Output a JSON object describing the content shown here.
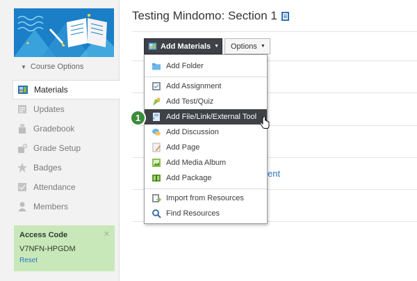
{
  "page": {
    "title": "Testing Mindomo: Section 1"
  },
  "sidebar": {
    "course_options": "Course Options",
    "items": [
      {
        "label": "Materials",
        "icon": "materials-icon",
        "active": true
      },
      {
        "label": "Updates",
        "icon": "updates-icon",
        "active": false
      },
      {
        "label": "Gradebook",
        "icon": "gradebook-icon",
        "active": false
      },
      {
        "label": "Grade Setup",
        "icon": "grade-setup-icon",
        "active": false
      },
      {
        "label": "Badges",
        "icon": "badge-icon",
        "active": false
      },
      {
        "label": "Attendance",
        "icon": "attendance-icon",
        "active": false
      },
      {
        "label": "Members",
        "icon": "members-icon",
        "active": false
      }
    ],
    "access_code": {
      "title": "Access Code",
      "code": "V7NFN-HPGDM",
      "reset": "Reset"
    }
  },
  "toolbar": {
    "add_materials": "Add Materials",
    "options": "Options"
  },
  "menu": {
    "items": [
      {
        "label": "Add Folder",
        "icon": "folder-icon"
      },
      {
        "label": "Add Assignment",
        "icon": "assignment-icon"
      },
      {
        "label": "Add Test/Quiz",
        "icon": "quiz-icon"
      },
      {
        "label": "Add File/Link/External Tool",
        "icon": "file-link-icon",
        "highlighted": true
      },
      {
        "label": "Add Discussion",
        "icon": "discussion-icon"
      },
      {
        "label": "Add Page",
        "icon": "page-icon"
      },
      {
        "label": "Add Media Album",
        "icon": "media-album-icon"
      },
      {
        "label": "Add Package",
        "icon": "package-icon"
      },
      {
        "label": "Import from Resources",
        "icon": "import-icon"
      },
      {
        "label": "Find Resources",
        "icon": "search-icon"
      }
    ]
  },
  "background": {
    "partial_link": "ent"
  },
  "annotation": {
    "step": "1"
  },
  "colors": {
    "accent": "#3e4146",
    "link": "#2a77c2",
    "access_bg": "#c9e8b9",
    "step_badge": "#3b8c3b",
    "banner": "#1b7fc7"
  }
}
